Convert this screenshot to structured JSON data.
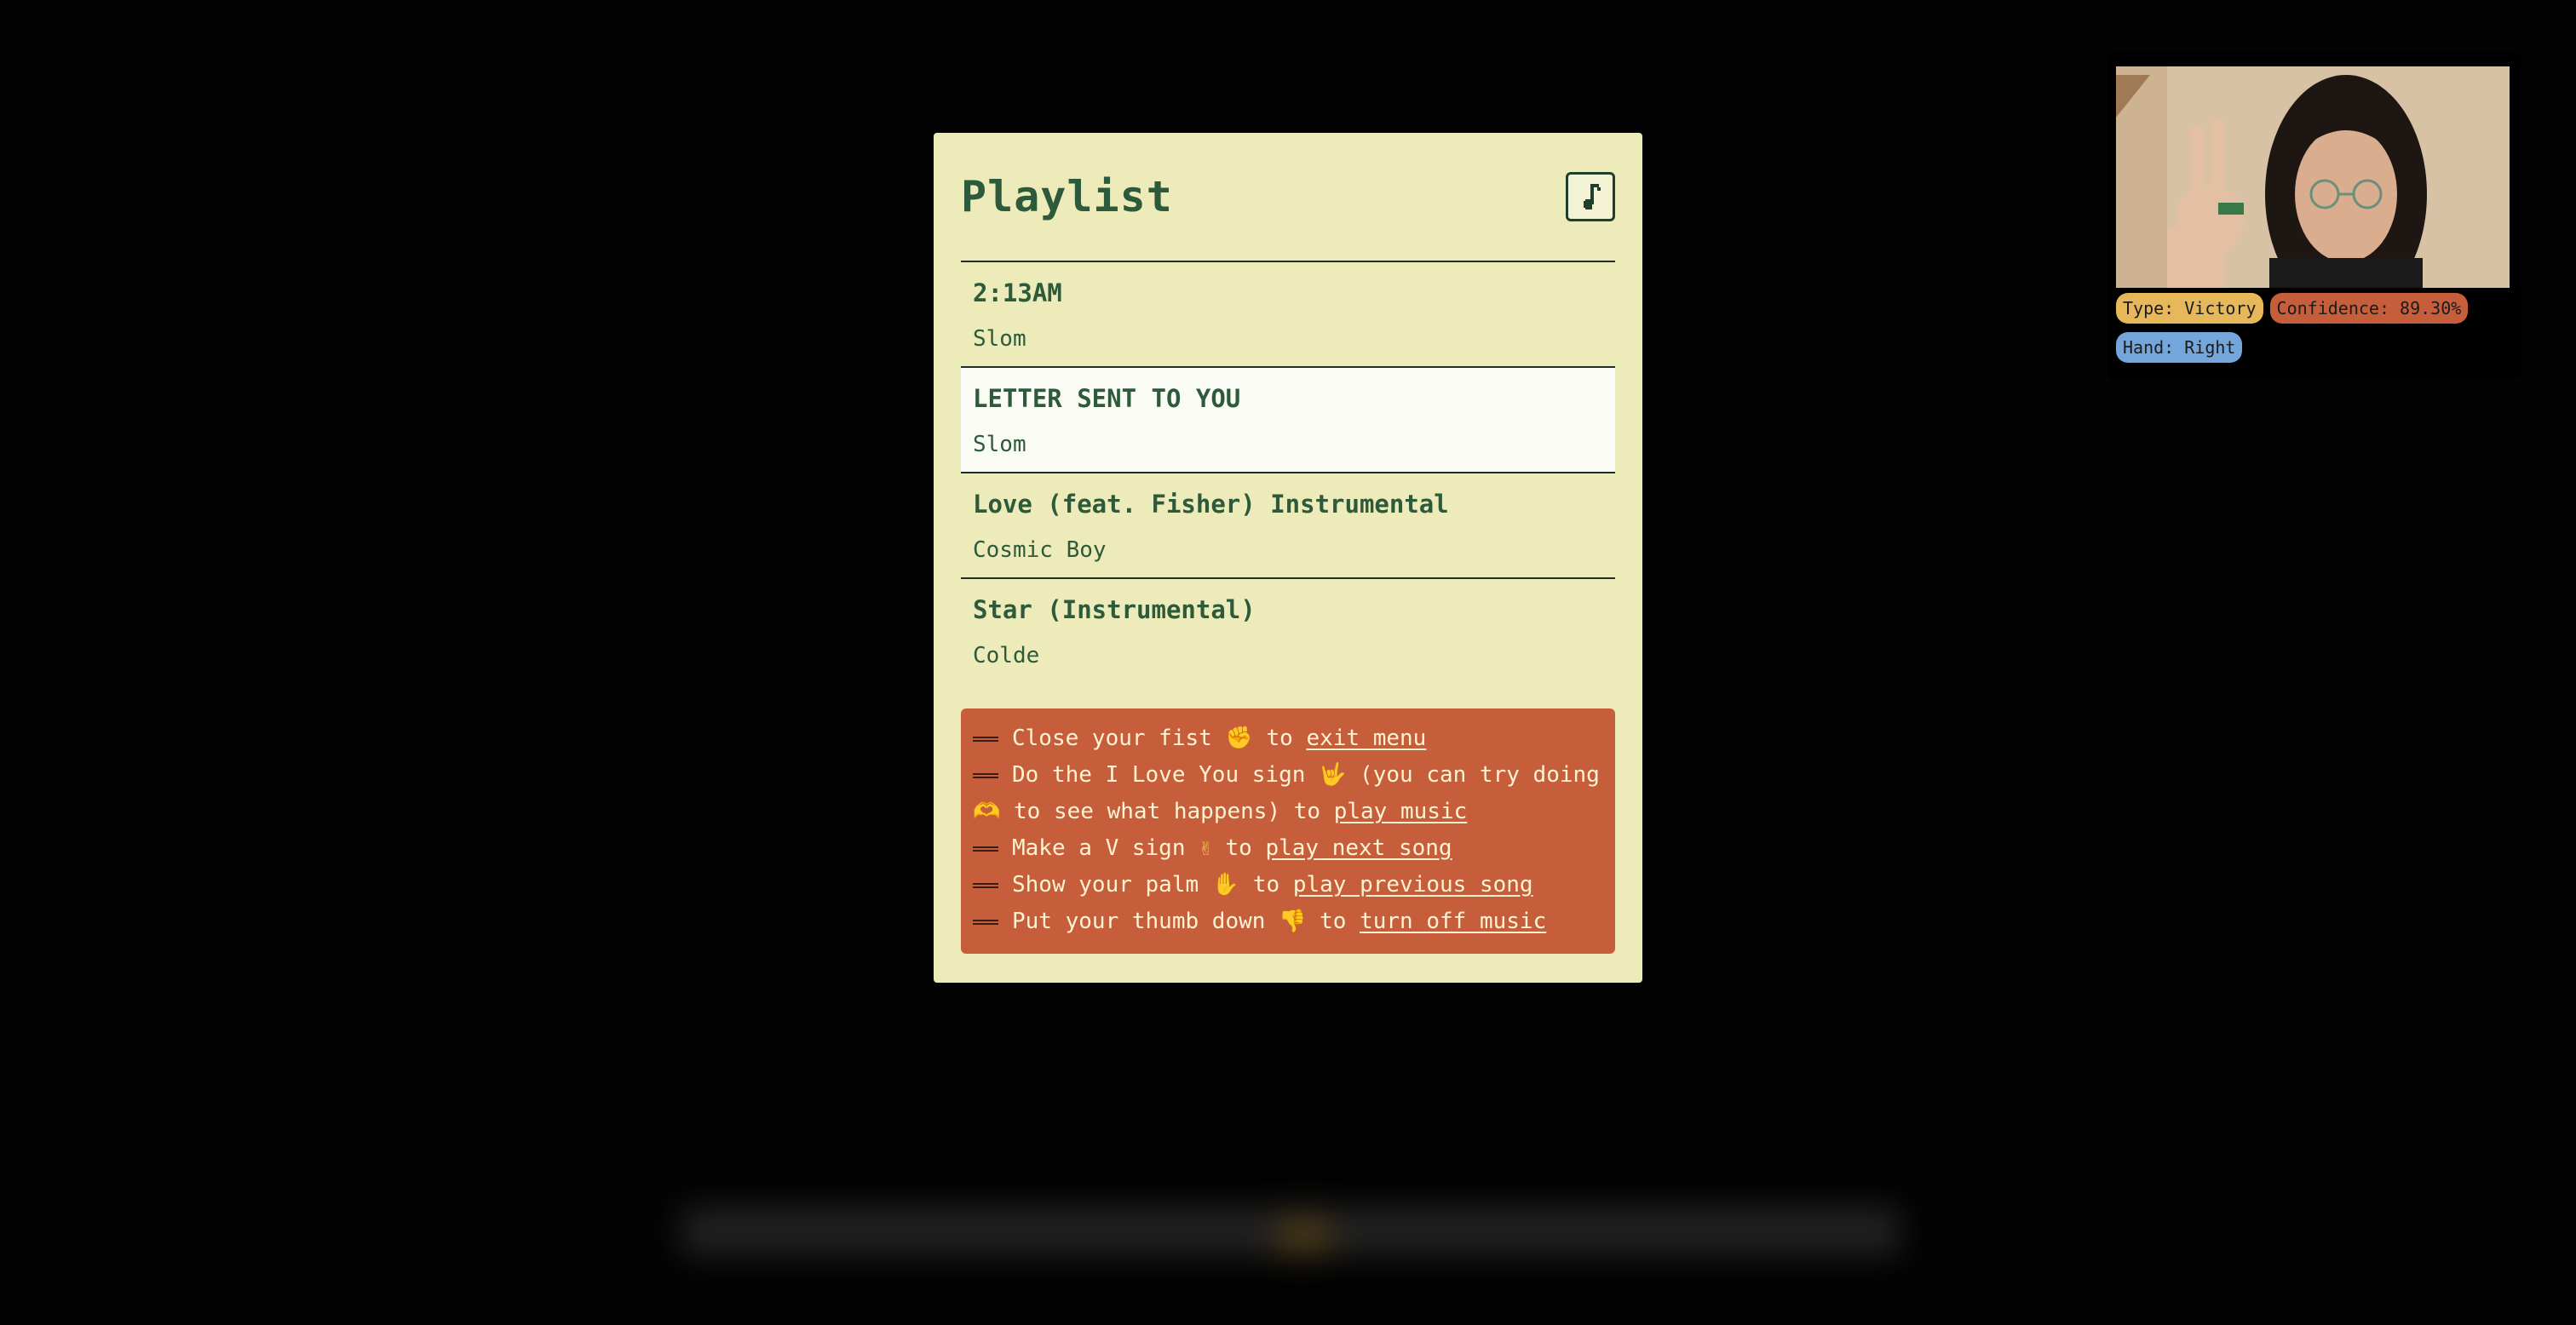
{
  "playlist": {
    "title": "Playlist",
    "songs": [
      {
        "title": "2:13AM",
        "artist": "Slom"
      },
      {
        "title": "LETTER SENT TO YOU",
        "artist": "Slom"
      },
      {
        "title": "Love (feat. Fisher) Instrumental",
        "artist": "Cosmic Boy"
      },
      {
        "title": "Star (Instrumental)",
        "artist": "Colde"
      }
    ],
    "selected_index": 1
  },
  "instructions": [
    {
      "before": "Close your fist ",
      "emoji": "✊",
      "middle": " to ",
      "action": "exit menu",
      "after": ""
    },
    {
      "before": "Do the I Love You sign ",
      "emoji": "🤟",
      "middle": " (you can try doing ",
      "emoji2": "🫶",
      "middle2": " to see what happens) to ",
      "action": "play music",
      "after": ""
    },
    {
      "before": "Make a V sign ",
      "emoji": "✌",
      "middle": " to ",
      "action": "play next song",
      "after": ""
    },
    {
      "before": "Show your palm ",
      "emoji": "✋",
      "middle": " to ",
      "action": "play previous song",
      "after": ""
    },
    {
      "before": "Put your thumb down ",
      "emoji": "👎",
      "middle": " to ",
      "action": "turn off music",
      "after": ""
    }
  ],
  "camera": {
    "type_label": "Type: Victory",
    "confidence_label": "Confidence: 89.30%",
    "hand_label": "Hand: Right"
  },
  "icons": {
    "music": "music-note-icon"
  },
  "colors": {
    "panel_bg": "#ecebb9",
    "accent_green": "#2c5a3a",
    "instructions_bg": "#c65e3c",
    "badge_type": "#e6b85a",
    "badge_conf": "#c65e3c",
    "badge_hand": "#74a6dc"
  }
}
